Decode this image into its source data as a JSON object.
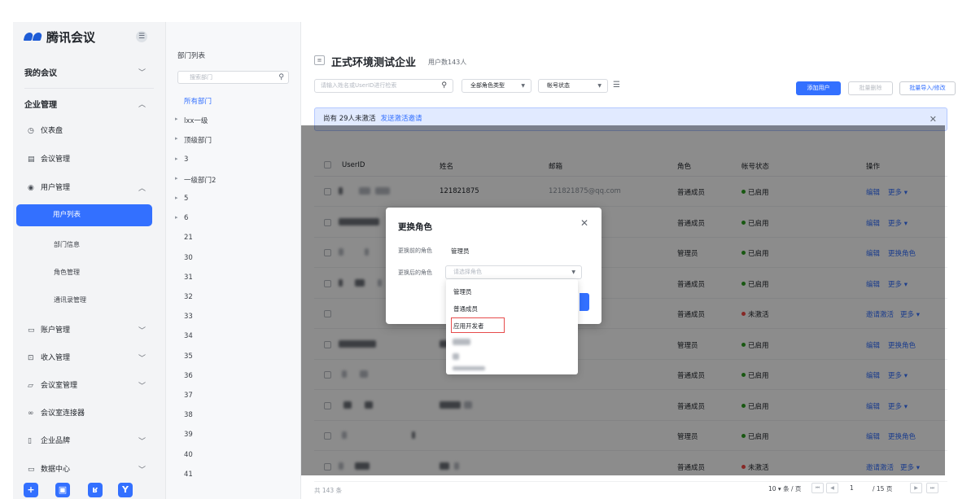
{
  "sidebar": {
    "brand": "腾讯会议",
    "fold_icon": "menu-fold-icon",
    "groups": [
      {
        "label": "我的会议",
        "expanded": false
      },
      {
        "label": "企业管理",
        "expanded": true
      }
    ],
    "items": [
      {
        "label": "仪表盘",
        "icon": "dashboard-icon"
      },
      {
        "label": "会议管理",
        "icon": "meeting-list-icon"
      },
      {
        "label": "用户管理",
        "icon": "user-group-icon",
        "expanded": true
      },
      {
        "label": "账户管理",
        "icon": "account-icon"
      },
      {
        "label": "收入管理",
        "icon": "income-icon"
      },
      {
        "label": "会议室管理",
        "icon": "room-icon"
      },
      {
        "label": "会议室连接器",
        "icon": "link-icon"
      },
      {
        "label": "企业品牌",
        "icon": "brand-icon"
      },
      {
        "label": "数据中心",
        "icon": "data-icon"
      }
    ],
    "user_subitems": [
      "用户列表",
      "部门信息",
      "角色管理",
      "通讯录管理"
    ],
    "active_subitem": "用户列表",
    "bottom_buttons": [
      "+",
      "▣",
      "ʁ",
      "Y"
    ]
  },
  "dept_panel": {
    "title": "部门列表",
    "search_placeholder": "搜索部门",
    "items": [
      {
        "label": "所有部门",
        "selected": true,
        "arrow": false
      },
      {
        "label": "lxx一级",
        "arrow": true
      },
      {
        "label": "顶级部门",
        "arrow": true
      },
      {
        "label": "3",
        "arrow": true
      },
      {
        "label": "一级部门2",
        "arrow": true
      },
      {
        "label": "5",
        "arrow": true
      },
      {
        "label": "6",
        "arrow": true
      },
      {
        "label": "21",
        "arrow": false
      },
      {
        "label": "30",
        "arrow": false
      },
      {
        "label": "31",
        "arrow": false
      },
      {
        "label": "32",
        "arrow": false
      },
      {
        "label": "33",
        "arrow": false
      },
      {
        "label": "34",
        "arrow": false
      },
      {
        "label": "35",
        "arrow": false
      },
      {
        "label": "36",
        "arrow": false
      },
      {
        "label": "37",
        "arrow": false
      },
      {
        "label": "38",
        "arrow": false
      },
      {
        "label": "39",
        "arrow": false
      },
      {
        "label": "40",
        "arrow": false
      },
      {
        "label": "41",
        "arrow": false
      }
    ]
  },
  "main": {
    "title": "正式环境测试企业",
    "user_count": "用户数143人",
    "search_placeholder": "请输入姓名或UserID进行检索",
    "role_filter": "全部角色类型",
    "status_filter": "帐号状态",
    "add_user": "添加用户",
    "batch_delete": "批量删除",
    "batch_import": "批量导入/修改",
    "notice_text": "尚有 29人未激活",
    "notice_link": "发送激活邀请",
    "columns": [
      "UserID",
      "姓名",
      "邮箱",
      "角色",
      "帐号状态",
      "操作"
    ],
    "rows": [
      {
        "name": "121821875",
        "email": "121821875@qq.com",
        "role": "普通成员",
        "status": "已启用",
        "status_color": "#2ea121",
        "op1": "编辑",
        "op2": "更多 ▾"
      },
      {
        "name": "",
        "email": "",
        "role": "普通成员",
        "status": "已启用",
        "status_color": "#2ea121",
        "op1": "编辑",
        "op2": "更多 ▾"
      },
      {
        "name": "",
        "email": "",
        "role": "管理员",
        "status": "已启用",
        "status_color": "#2ea121",
        "op1": "编辑",
        "op2": "更换角色"
      },
      {
        "name": "",
        "email": "",
        "role": "普通成员",
        "status": "已启用",
        "status_color": "#2ea121",
        "op1": "编辑",
        "op2": "更多 ▾"
      },
      {
        "name": "",
        "email": "",
        "role": "普通成员",
        "status": "未激活",
        "status_color": "#f54a45",
        "op1": "邀请激活",
        "op2": "更多 ▾"
      },
      {
        "name": "",
        "email": "",
        "role": "管理员",
        "status": "已启用",
        "status_color": "#2ea121",
        "op1": "编辑",
        "op2": "更换角色"
      },
      {
        "name": "",
        "email": "",
        "role": "普通成员",
        "status": "已启用",
        "status_color": "#2ea121",
        "op1": "编辑",
        "op2": "更多 ▾"
      },
      {
        "name": "",
        "email": "",
        "role": "普通成员",
        "status": "已启用",
        "status_color": "#2ea121",
        "op1": "编辑",
        "op2": "更多 ▾"
      },
      {
        "name": "",
        "email": "",
        "role": "管理员",
        "status": "已启用",
        "status_color": "#2ea121",
        "op1": "编辑",
        "op2": "更换角色"
      },
      {
        "name": "",
        "email": "",
        "role": "普通成员",
        "status": "未激活",
        "status_color": "#f54a45",
        "op1": "邀请激活",
        "op2": "更多 ▾"
      }
    ],
    "total": "共 143 条",
    "page_size": "10 ▾ 条 / 页",
    "current_page": "1",
    "total_pages": "/ 15 页"
  },
  "dialog": {
    "title": "更换角色",
    "before_label": "更换前的角色",
    "before_value": "管理员",
    "after_label": "更换后的角色",
    "after_placeholder": "请选择角色",
    "options": [
      "管理员",
      "普通成员",
      "应用开发者"
    ],
    "highlighted_option": "应用开发者"
  }
}
